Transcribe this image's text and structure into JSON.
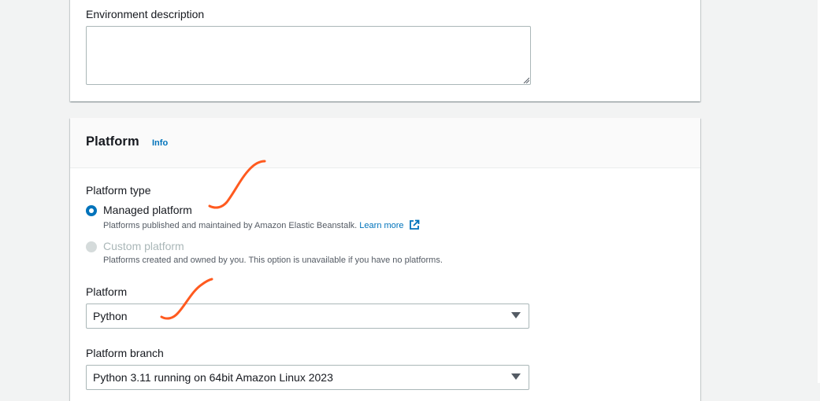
{
  "environment_description": {
    "label": "Environment description",
    "value": ""
  },
  "platform_section": {
    "title": "Platform",
    "info_link": "Info",
    "platform_type": {
      "label": "Platform type",
      "options": [
        {
          "label": "Managed platform",
          "description": "Platforms published and maintained by Amazon Elastic Beanstalk.",
          "link": "Learn more",
          "selected": true,
          "disabled": false
        },
        {
          "label": "Custom platform",
          "description": "Platforms created and owned by you. This option is unavailable if you have no platforms.",
          "selected": false,
          "disabled": true
        }
      ]
    },
    "platform": {
      "label": "Platform",
      "value": "Python"
    },
    "platform_branch": {
      "label": "Platform branch",
      "value": "Python 3.11 running on 64bit Amazon Linux 2023"
    }
  },
  "colors": {
    "accent": "#0073bb",
    "annotation": "#ff5a1f",
    "background": "#f2f3f3"
  },
  "icons": {
    "external_link": "external-link-icon",
    "dropdown": "chevron-down-icon"
  }
}
